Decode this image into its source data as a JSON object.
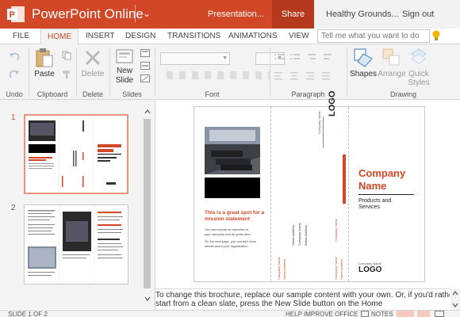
{
  "app": {
    "name": "PowerPoint Online",
    "doc_title": "Presentation...",
    "share_label": "Share",
    "account": "Healthy Grounds...",
    "signout_label": "Sign out",
    "brand_color": "#d24726"
  },
  "tabs": [
    {
      "label": "FILE",
      "active": false
    },
    {
      "label": "HOME",
      "active": true
    },
    {
      "label": "INSERT",
      "active": false
    },
    {
      "label": "DESIGN",
      "active": false
    },
    {
      "label": "TRANSITIONS",
      "active": false
    },
    {
      "label": "ANIMATIONS",
      "active": false
    },
    {
      "label": "VIEW",
      "active": false
    }
  ],
  "tell_me_placeholder": "Tell me what you want to do",
  "ribbon": {
    "groups": {
      "undo": "Undo",
      "clipboard": "Clipboard",
      "delete": "Delete",
      "slides": "Slides",
      "font": "Font",
      "paragraph": "Paragraph",
      "drawing": "Drawing"
    },
    "buttons": {
      "paste": "Paste",
      "delete": "Delete",
      "new_slide_1": "New",
      "new_slide_2": "Slide",
      "shapes": "Shapes",
      "arrange": "Arrange",
      "quick_styles_1": "Quick",
      "quick_styles_2": "Styles"
    }
  },
  "slides_panel": {
    "numbers": [
      "1",
      "2"
    ],
    "selected": 1
  },
  "slide": {
    "mission_1": "This is a great spot for a",
    "mission_2": "mission statement",
    "body_1": "You can include an overview of",
    "body_2": "your company and its goals here.",
    "body_3": "On the next page, you can add more",
    "body_4": "details about your organization.",
    "company_1": "Company",
    "company_2": "Name",
    "products_1": "Products and",
    "products_2": "Services",
    "logo": "LOGO",
    "logo_small_text": "Company Name",
    "address_line": "Street Address",
    "accent_color": "#d24726"
  },
  "notes": {
    "text": "To change this brochure, replace our sample content with your own. Or, if you'd rather start from a clean slate, press the New Slide button on the Home"
  },
  "status": {
    "slide_count": "SLIDE 1 OF 2",
    "help_improve": "HELP IMPROVE OFFICE",
    "notes_label": "NOTES"
  }
}
